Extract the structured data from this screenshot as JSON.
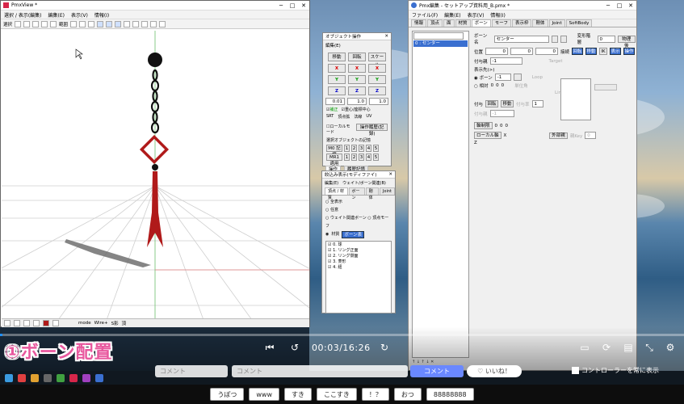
{
  "pmxview": {
    "title": "PmxView *",
    "menu": [
      "選択 / 表示(編集)",
      "編集(E)",
      "表示(V)",
      "情報(I)"
    ],
    "toolbar_label": "選択",
    "range_label": "範囲",
    "status_items": [
      "mode",
      "Wire+",
      "S影",
      "頂"
    ]
  },
  "object_op": {
    "title": "オブジェクト操作",
    "menu": "編集(E)",
    "buttons": [
      "移動",
      "回転",
      "スケール"
    ],
    "x": "X",
    "y": "Y",
    "z": "Z",
    "values": [
      "0.01",
      "1.0",
      "1.0"
    ],
    "check1": "補正",
    "check2": "重心/座標中心",
    "row_labels": [
      "SRT",
      "頂点拡",
      "法線",
      "UV"
    ],
    "local_mode": "ローカルモード",
    "history": "操作履歴(記録)",
    "selected_obj": "選択オブジェクトの記憶",
    "mem_rows": [
      "M0 記憶",
      "MR1 適用"
    ],
    "mem_cells": [
      "1",
      "2",
      "3",
      "4",
      "5"
    ],
    "tab1": "操作",
    "tab2": "履歴記憶"
  },
  "narrow": {
    "title": "絞込み表示(モディファイ)",
    "menu": [
      "編集(E)",
      "ウェイト/ボーン関連(B)"
    ],
    "tabs": [
      "頂点 / 材質",
      "ボーン",
      "剛体",
      "Joint"
    ],
    "all": "全表示",
    "any": "任意",
    "weight_bone": "ウェイト関連ボーン",
    "vertex_morph": "頂点モーフ",
    "material": "材質",
    "material_btn": "ボーン表",
    "list": [
      "0. 球",
      "1. リング正面",
      "2. リング側面",
      "3. 菱形",
      "4. 紐"
    ]
  },
  "pmxe": {
    "title": "Pmx編集 - セットアップ資料用_B.pmx *",
    "menu": [
      "ファイル(F)",
      "編集(E)",
      "表示(V)",
      "情報(I)"
    ],
    "tabs": [
      "情報",
      "頂点",
      "面",
      "材質",
      "ボーン",
      "モーフ",
      "表示枠",
      "剛体",
      "Joint",
      "SoftBody"
    ],
    "bone_label": "ボーン名",
    "bone_name": "センター",
    "transform_label": "変形階層",
    "transform_value": "0",
    "physics_label": "物理後",
    "pos_label": "位置",
    "pos": [
      "0",
      "0",
      "0"
    ],
    "connect_label": "接続",
    "rot_label": "回転",
    "move_label": "移動",
    "ik_label": "IK",
    "display_label": "表示",
    "op_label": "操作",
    "bone_list_item": "0 : センター",
    "tail_label": "表示先(>)",
    "radio_bone": "ボーン",
    "radio_offset": "相対",
    "tail_val": "-1",
    "rotate_add": "付与",
    "move_add": "移動",
    "add_parent": "付与親",
    "axis_fix": "軸制限",
    "local_axis": "ローカル軸",
    "ext_parent": "外部親",
    "target": "Target",
    "loop": "Loop",
    "unit_angle": "単位角",
    "link": "Link",
    "add_val": "-1",
    "add_rate": "付与率",
    "add_rate_val": "1",
    "key_label": "親Key",
    "key_val": "0",
    "x": "X",
    "z": "Z",
    "zeros": [
      "0",
      "0",
      "0"
    ],
    "range_label": "角度制限",
    "ext_btn": "外部親"
  },
  "video": {
    "time": "00:03/16:26",
    "caption": "①ボーン配置",
    "progress": 0.003,
    "comment_placeholder": "コメント",
    "comment_btn": "コメント",
    "like_btn": "いいね！",
    "controller_label": "コントローラーを常に表示"
  },
  "footer_chips": [
    "うぽつ",
    "www",
    "すき",
    "ここすき",
    "！？",
    "おつ",
    "88888888"
  ],
  "colors": {
    "caption": "#e8589e",
    "pmxview_accent": "#d6264a",
    "bone_red": "#b01a1a",
    "progress": "#1e90ff"
  }
}
